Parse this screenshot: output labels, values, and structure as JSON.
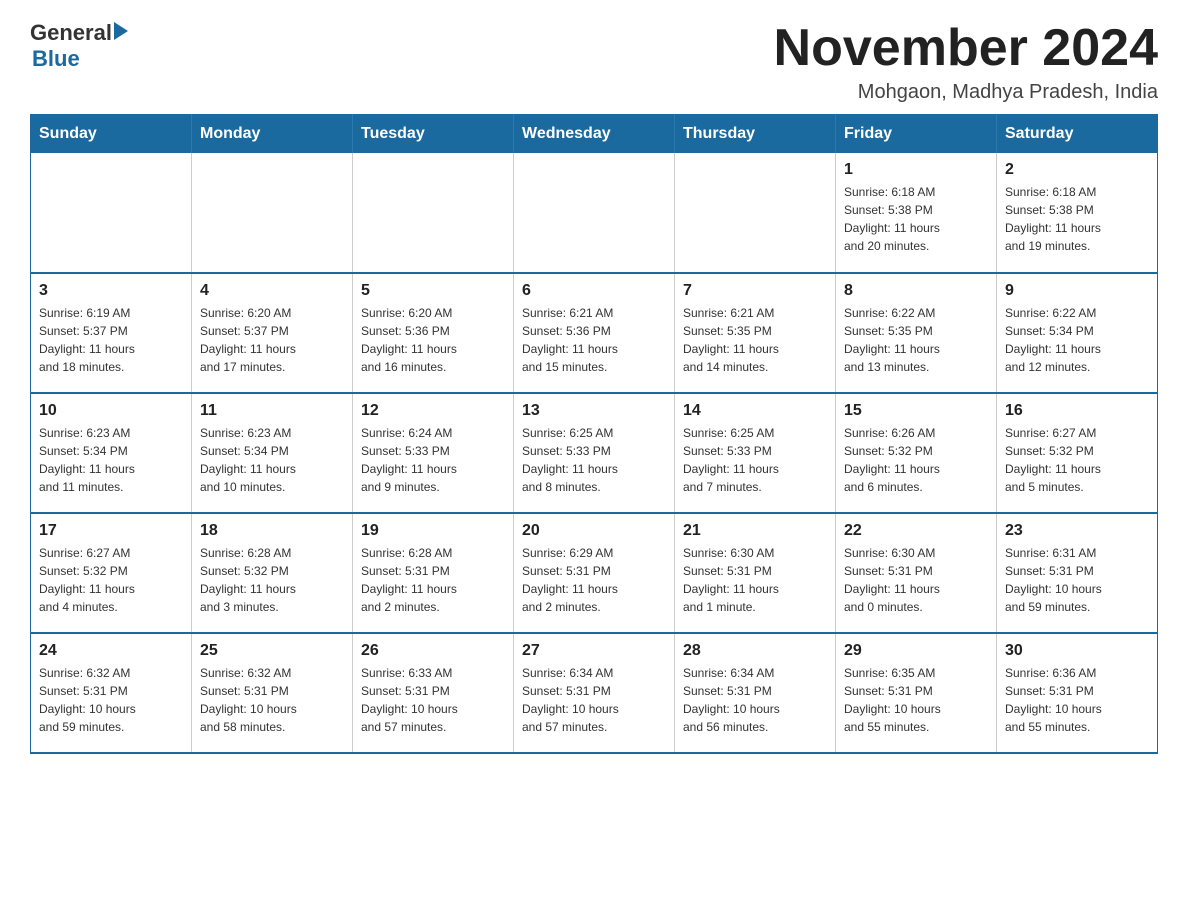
{
  "header": {
    "logo_general": "General",
    "logo_blue": "Blue",
    "month_title": "November 2024",
    "location": "Mohgaon, Madhya Pradesh, India"
  },
  "weekdays": [
    "Sunday",
    "Monday",
    "Tuesday",
    "Wednesday",
    "Thursday",
    "Friday",
    "Saturday"
  ],
  "weeks": [
    [
      {
        "day": "",
        "info": ""
      },
      {
        "day": "",
        "info": ""
      },
      {
        "day": "",
        "info": ""
      },
      {
        "day": "",
        "info": ""
      },
      {
        "day": "",
        "info": ""
      },
      {
        "day": "1",
        "info": "Sunrise: 6:18 AM\nSunset: 5:38 PM\nDaylight: 11 hours\nand 20 minutes."
      },
      {
        "day": "2",
        "info": "Sunrise: 6:18 AM\nSunset: 5:38 PM\nDaylight: 11 hours\nand 19 minutes."
      }
    ],
    [
      {
        "day": "3",
        "info": "Sunrise: 6:19 AM\nSunset: 5:37 PM\nDaylight: 11 hours\nand 18 minutes."
      },
      {
        "day": "4",
        "info": "Sunrise: 6:20 AM\nSunset: 5:37 PM\nDaylight: 11 hours\nand 17 minutes."
      },
      {
        "day": "5",
        "info": "Sunrise: 6:20 AM\nSunset: 5:36 PM\nDaylight: 11 hours\nand 16 minutes."
      },
      {
        "day": "6",
        "info": "Sunrise: 6:21 AM\nSunset: 5:36 PM\nDaylight: 11 hours\nand 15 minutes."
      },
      {
        "day": "7",
        "info": "Sunrise: 6:21 AM\nSunset: 5:35 PM\nDaylight: 11 hours\nand 14 minutes."
      },
      {
        "day": "8",
        "info": "Sunrise: 6:22 AM\nSunset: 5:35 PM\nDaylight: 11 hours\nand 13 minutes."
      },
      {
        "day": "9",
        "info": "Sunrise: 6:22 AM\nSunset: 5:34 PM\nDaylight: 11 hours\nand 12 minutes."
      }
    ],
    [
      {
        "day": "10",
        "info": "Sunrise: 6:23 AM\nSunset: 5:34 PM\nDaylight: 11 hours\nand 11 minutes."
      },
      {
        "day": "11",
        "info": "Sunrise: 6:23 AM\nSunset: 5:34 PM\nDaylight: 11 hours\nand 10 minutes."
      },
      {
        "day": "12",
        "info": "Sunrise: 6:24 AM\nSunset: 5:33 PM\nDaylight: 11 hours\nand 9 minutes."
      },
      {
        "day": "13",
        "info": "Sunrise: 6:25 AM\nSunset: 5:33 PM\nDaylight: 11 hours\nand 8 minutes."
      },
      {
        "day": "14",
        "info": "Sunrise: 6:25 AM\nSunset: 5:33 PM\nDaylight: 11 hours\nand 7 minutes."
      },
      {
        "day": "15",
        "info": "Sunrise: 6:26 AM\nSunset: 5:32 PM\nDaylight: 11 hours\nand 6 minutes."
      },
      {
        "day": "16",
        "info": "Sunrise: 6:27 AM\nSunset: 5:32 PM\nDaylight: 11 hours\nand 5 minutes."
      }
    ],
    [
      {
        "day": "17",
        "info": "Sunrise: 6:27 AM\nSunset: 5:32 PM\nDaylight: 11 hours\nand 4 minutes."
      },
      {
        "day": "18",
        "info": "Sunrise: 6:28 AM\nSunset: 5:32 PM\nDaylight: 11 hours\nand 3 minutes."
      },
      {
        "day": "19",
        "info": "Sunrise: 6:28 AM\nSunset: 5:31 PM\nDaylight: 11 hours\nand 2 minutes."
      },
      {
        "day": "20",
        "info": "Sunrise: 6:29 AM\nSunset: 5:31 PM\nDaylight: 11 hours\nand 2 minutes."
      },
      {
        "day": "21",
        "info": "Sunrise: 6:30 AM\nSunset: 5:31 PM\nDaylight: 11 hours\nand 1 minute."
      },
      {
        "day": "22",
        "info": "Sunrise: 6:30 AM\nSunset: 5:31 PM\nDaylight: 11 hours\nand 0 minutes."
      },
      {
        "day": "23",
        "info": "Sunrise: 6:31 AM\nSunset: 5:31 PM\nDaylight: 10 hours\nand 59 minutes."
      }
    ],
    [
      {
        "day": "24",
        "info": "Sunrise: 6:32 AM\nSunset: 5:31 PM\nDaylight: 10 hours\nand 59 minutes."
      },
      {
        "day": "25",
        "info": "Sunrise: 6:32 AM\nSunset: 5:31 PM\nDaylight: 10 hours\nand 58 minutes."
      },
      {
        "day": "26",
        "info": "Sunrise: 6:33 AM\nSunset: 5:31 PM\nDaylight: 10 hours\nand 57 minutes."
      },
      {
        "day": "27",
        "info": "Sunrise: 6:34 AM\nSunset: 5:31 PM\nDaylight: 10 hours\nand 57 minutes."
      },
      {
        "day": "28",
        "info": "Sunrise: 6:34 AM\nSunset: 5:31 PM\nDaylight: 10 hours\nand 56 minutes."
      },
      {
        "day": "29",
        "info": "Sunrise: 6:35 AM\nSunset: 5:31 PM\nDaylight: 10 hours\nand 55 minutes."
      },
      {
        "day": "30",
        "info": "Sunrise: 6:36 AM\nSunset: 5:31 PM\nDaylight: 10 hours\nand 55 minutes."
      }
    ]
  ]
}
